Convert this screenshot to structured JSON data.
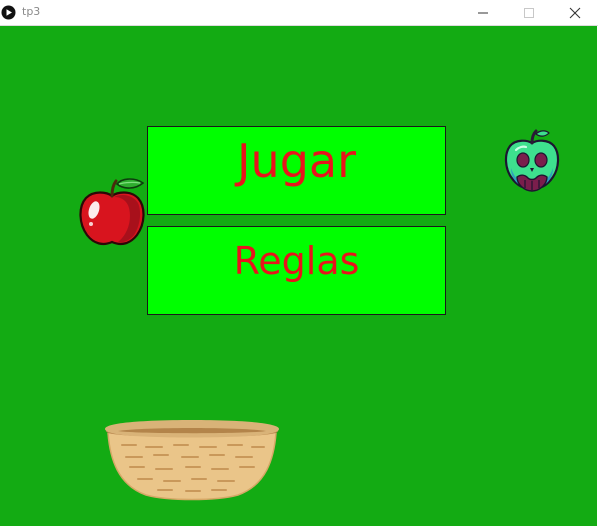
{
  "window": {
    "title": "tp3",
    "controls": {
      "minimize_icon": "minimize-icon",
      "maximize_icon": "maximize-icon",
      "close_icon": "close-icon"
    }
  },
  "game": {
    "background_color": "#13ab13",
    "menu": {
      "play_label": "Jugar",
      "rules_label": "Reglas",
      "button_color": "#00ff00",
      "text_color": "#e8141c"
    },
    "sprites": [
      "red-apple-icon",
      "poison-apple-icon",
      "basket-icon"
    ]
  }
}
